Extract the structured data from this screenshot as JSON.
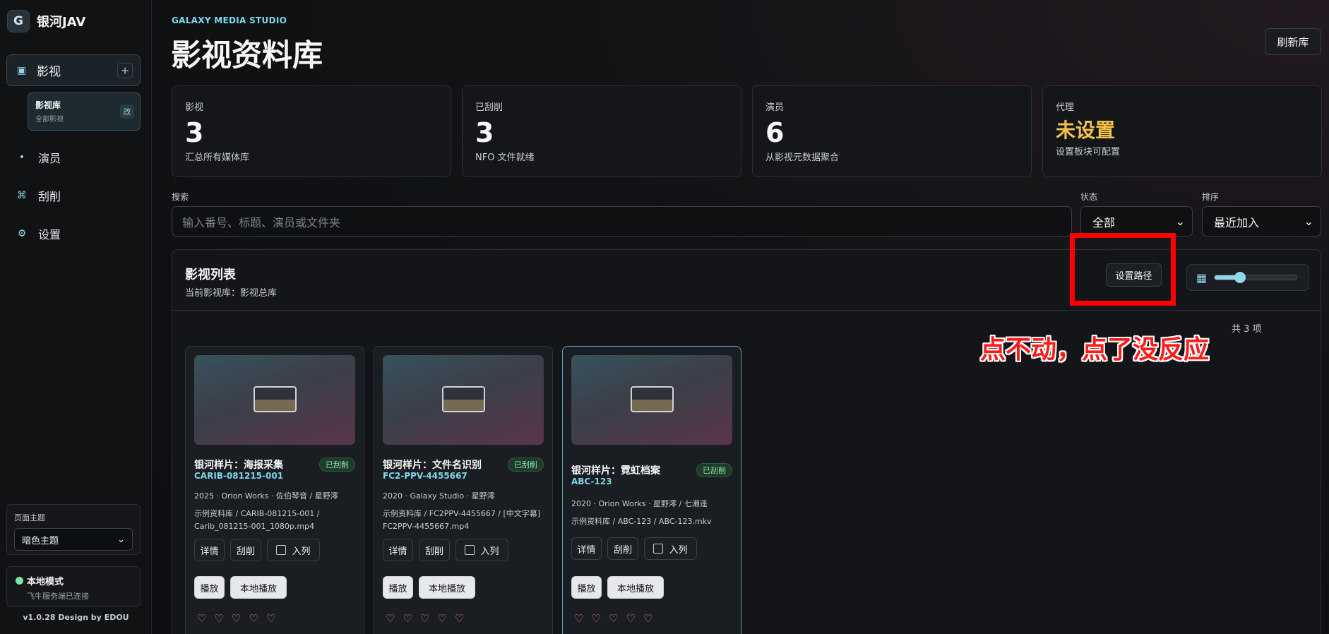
{
  "brand": {
    "logo_letter": "G",
    "name": "银河JAV"
  },
  "nav": {
    "main": {
      "label": "影视",
      "add_symbol": "+"
    },
    "sub": {
      "title": "影视库",
      "desc": "全部影视",
      "edit_label": "改"
    },
    "items": [
      {
        "label": "演员",
        "icon": "dot-icon"
      },
      {
        "label": "刮削",
        "icon": "command-icon"
      },
      {
        "label": "设置",
        "icon": "gear-icon"
      }
    ]
  },
  "theme": {
    "label": "页面主题",
    "value": "暗色主题"
  },
  "status": {
    "title": "本地模式",
    "desc": "飞牛服务端已连接",
    "dot_color": "#7ee2a0"
  },
  "version": "v1.0.28 Design by EDOU",
  "header": {
    "eyebrow": "GALAXY MEDIA STUDIO",
    "title": "影视资料库",
    "refresh_label": "刷新库"
  },
  "stats": [
    {
      "label": "影视",
      "value": "3",
      "desc": "汇总所有媒体库"
    },
    {
      "label": "已刮削",
      "value": "3",
      "desc": "NFO 文件就绪"
    },
    {
      "label": "演员",
      "value": "6",
      "desc": "从影视元数据聚合"
    },
    {
      "label": "代理",
      "value": "未设置",
      "desc": "设置板块可配置"
    }
  ],
  "filters": {
    "search_label": "搜索",
    "search_placeholder": "输入番号、标题、演员或文件夹",
    "status_label": "状态",
    "status_value": "全部",
    "sort_label": "排序",
    "sort_value": "最近加入"
  },
  "list": {
    "title": "影视列表",
    "subtitle": "当前影视库：影视总库",
    "set_path_label": "设置路径",
    "zoom_level": 0.31,
    "count": "共 3 项"
  },
  "cards": [
    {
      "title": "银河样片：海报采集",
      "code": "CARIB-081215-001",
      "badge": "已刮削",
      "meta": "2025 · Orion Works · 佐伯琴音 / 星野澪",
      "path": "示例资料库 / CARIB-081215-001 / Carib_081215-001_1080p.mp4",
      "btn_detail": "详情",
      "btn_scrape": "刮削",
      "btn_queue": "入列",
      "btn_play": "播放",
      "btn_local": "本地播放",
      "hearts": [
        "♡",
        "♡",
        "♡",
        "♡",
        "♡"
      ]
    },
    {
      "title": "银河样片：文件名识别",
      "code": "FC2-PPV-4455667",
      "badge": "已刮削",
      "meta": "2020 · Galaxy Studio · 星野澪",
      "path": "示例资料库 / FC2PPV-4455667 / [中文字幕] FC2PPV-4455667.mp4",
      "btn_detail": "详情",
      "btn_scrape": "刮削",
      "btn_queue": "入列",
      "btn_play": "播放",
      "btn_local": "本地播放",
      "hearts": [
        "♡",
        "♡",
        "♡",
        "♡",
        "♡"
      ]
    },
    {
      "title": "银河样片：霓虹档案",
      "code": "ABC-123",
      "badge": "已刮削",
      "meta": "2020 · Orion Works · 星野澪 / 七濑遥",
      "path": "示例资料库 / ABC-123 / ABC-123.mkv",
      "btn_detail": "详情",
      "btn_scrape": "刮削",
      "btn_queue": "入列",
      "btn_play": "播放",
      "btn_local": "本地播放",
      "hearts": [
        "♡",
        "♡",
        "♡",
        "♡",
        "♡"
      ]
    }
  ],
  "annotation": {
    "text": "点不动，点了没反应",
    "color": "#ff0000"
  }
}
